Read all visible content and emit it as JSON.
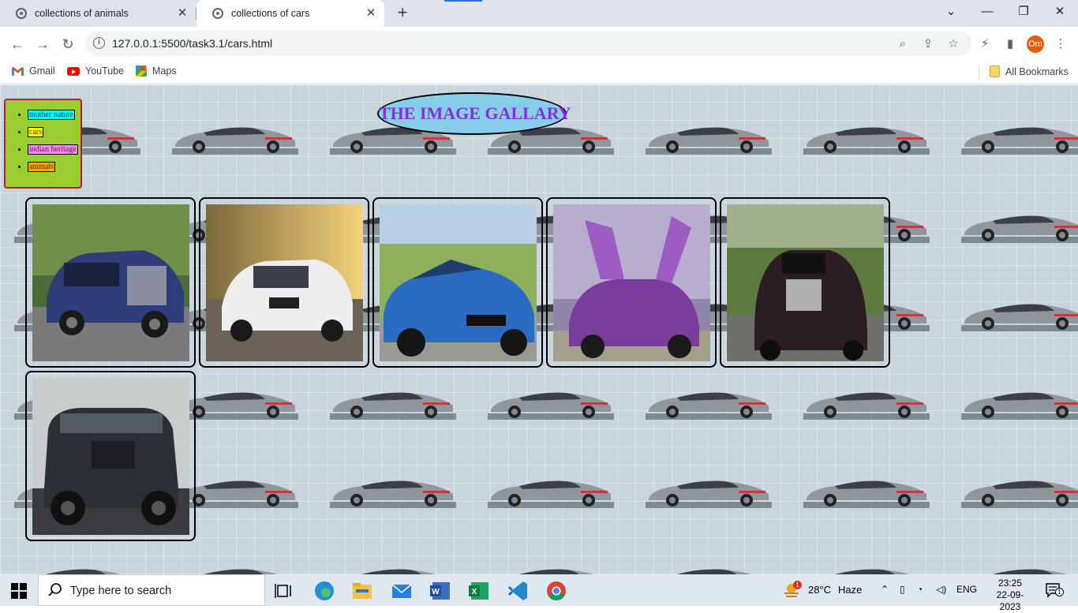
{
  "browser": {
    "tabs": [
      {
        "title": "collections of animals",
        "active": false
      },
      {
        "title": "collections of cars",
        "active": true
      }
    ],
    "url": "127.0.0.1:5500/task3.1/cars.html",
    "profile_initials": "Om",
    "bookmarks": [
      {
        "label": "Gmail",
        "icon": "gmail-icon"
      },
      {
        "label": "YouTube",
        "icon": "youtube-icon"
      },
      {
        "label": "Maps",
        "icon": "maps-icon"
      }
    ],
    "all_bookmarks_label": "All Bookmarks"
  },
  "page": {
    "title": "THE IMAGE GALLARY",
    "nav_links": [
      {
        "label": "mother nature",
        "highlight": "#00ffff"
      },
      {
        "label": "cars",
        "highlight": "#ffff00"
      },
      {
        "label": "indian heritage",
        "highlight": "#ff88ff"
      },
      {
        "label": "animals",
        "highlight": "#ffa500"
      }
    ],
    "gallery": [
      {
        "subject": "blue luxury sedan on forest road",
        "icon": "car-photo"
      },
      {
        "subject": "white sedan on sunlit road",
        "icon": "car-photo"
      },
      {
        "subject": "blue convertible sports car",
        "icon": "car-photo"
      },
      {
        "subject": "purple hypercar with doors open",
        "icon": "car-photo"
      },
      {
        "subject": "black luxury sedan on highway",
        "icon": "car-photo"
      },
      {
        "subject": "black off-road SUV on wet road",
        "icon": "car-photo"
      }
    ],
    "colors": {
      "nav_bg": "#9acd32",
      "nav_border": "#b22222",
      "title_bg": "#87ceeb",
      "title_text": "#8a2be2"
    }
  },
  "taskbar": {
    "search_placeholder": "Type here to search",
    "weather": {
      "temp": "28°C",
      "condition": "Haze",
      "badge": "1"
    },
    "language": "ENG",
    "time": "23:25",
    "date": "22-09-2023",
    "notification_badge": "1"
  }
}
